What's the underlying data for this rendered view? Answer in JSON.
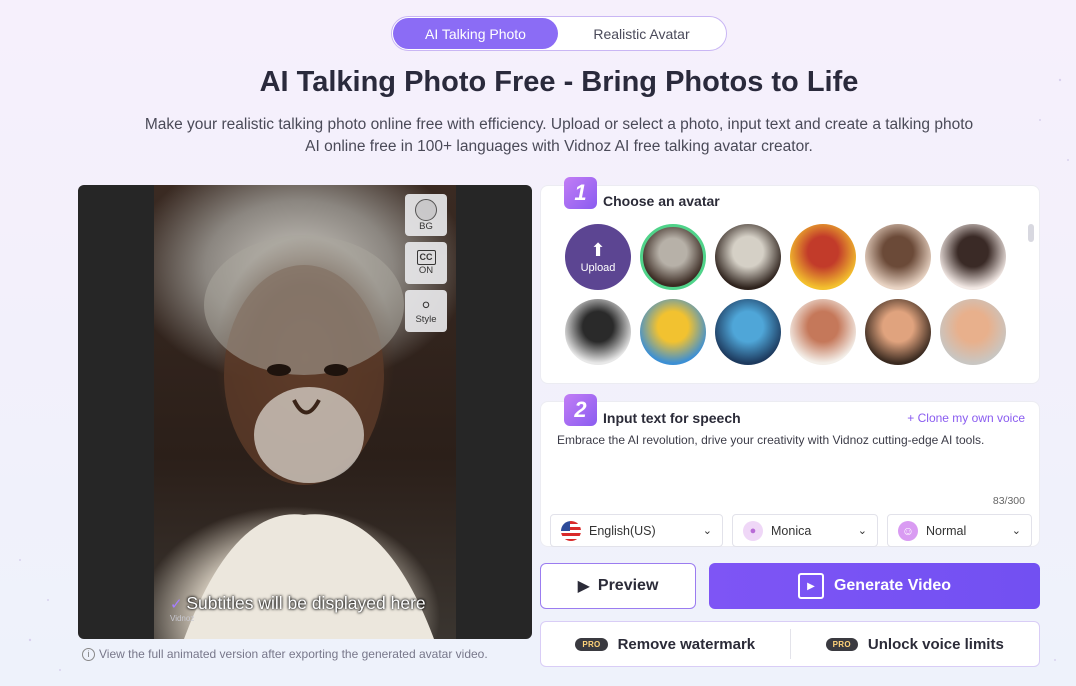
{
  "mode_tabs": {
    "active": "AI Talking Photo",
    "inactive": "Realistic Avatar"
  },
  "page_title": "AI Talking Photo Free - Bring Photos to Life",
  "page_subtitle_line1": "Make your realistic talking photo online free with efficiency. Upload or select a photo, input text and create a talking photo",
  "page_subtitle_line2": "AI online free in 100+ languages with Vidnoz AI free talking avatar creator.",
  "preview": {
    "side_buttons": {
      "bg": "BG",
      "cc": "ON",
      "cc_icon": "CC",
      "style": "Style"
    },
    "subtitle_placeholder": "Subtitles will be displayed here",
    "watermark": "Vidnoz",
    "export_note": "View the full animated version after exporting the generated avatar video."
  },
  "step1": {
    "number": "1",
    "title": "Choose an avatar",
    "upload_label": "Upload",
    "avatars": [
      {
        "name": "elder-man",
        "colors": [
          "#3a2a22",
          "#b7b1a8"
        ]
      },
      {
        "name": "elder-man-text",
        "colors": [
          "#2e221c",
          "#d5d0c6"
        ]
      },
      {
        "name": "yellow-cartoon",
        "colors": [
          "#f4c12e",
          "#c23b2a"
        ]
      },
      {
        "name": "woman-1",
        "colors": [
          "#e9d4c4",
          "#6b4a38"
        ]
      },
      {
        "name": "woman-2",
        "colors": [
          "#f2e8e4",
          "#3a2a26"
        ]
      },
      {
        "name": "woman-bw",
        "colors": [
          "#e8e8e8",
          "#2a2a2a"
        ]
      },
      {
        "name": "woman-yellow",
        "colors": [
          "#3c8fd4",
          "#f2c230"
        ]
      },
      {
        "name": "blue-avatar",
        "colors": [
          "#1d3a5e",
          "#4fa6d8"
        ]
      },
      {
        "name": "cartoon-boy",
        "colors": [
          "#f4efe9",
          "#c5785a"
        ]
      },
      {
        "name": "cartoon-girl",
        "colors": [
          "#3a2a20",
          "#e0a37e"
        ]
      },
      {
        "name": "cartoon-girl-2",
        "colors": [
          "#c9c6c2",
          "#e8b08c"
        ]
      }
    ]
  },
  "step2": {
    "number": "2",
    "title": "Input text for speech",
    "clone_link": "Clone my own voice",
    "speech_text": "Embrace the AI revolution, drive your creativity with Vidnoz cutting-edge AI tools.",
    "counter": "83/300",
    "language": "English(US)",
    "voice": "Monica",
    "speed": "Normal"
  },
  "actions": {
    "preview": "Preview",
    "generate": "Generate Video",
    "pro_badge": "PRO",
    "remove_watermark": "Remove watermark",
    "unlock_voice": "Unlock voice limits"
  }
}
